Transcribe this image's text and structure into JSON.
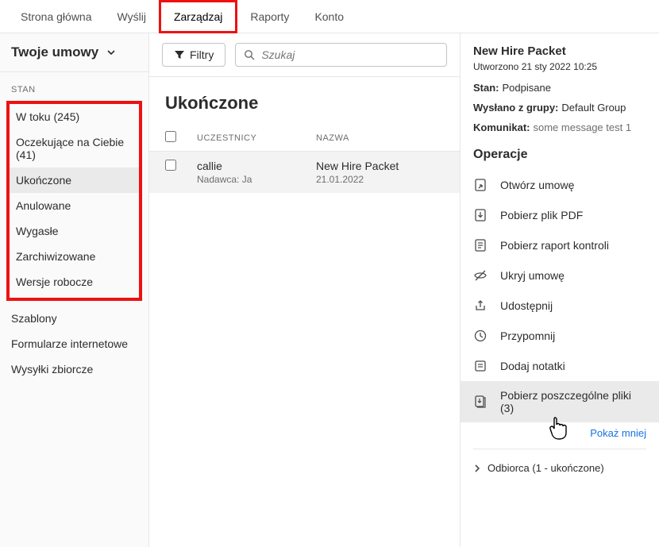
{
  "topnav": [
    {
      "label": "Strona główna",
      "name": "nav-home"
    },
    {
      "label": "Wyślij",
      "name": "nav-send"
    },
    {
      "label": "Zarządzaj",
      "name": "nav-manage",
      "highlighted": true
    },
    {
      "label": "Raporty",
      "name": "nav-reports"
    },
    {
      "label": "Konto",
      "name": "nav-account"
    }
  ],
  "sidebar": {
    "title": "Twoje umowy",
    "stan_label": "STAN",
    "status_items": [
      {
        "label": "W toku (245)",
        "name": "status-in-progress"
      },
      {
        "label": "Oczekujące na Ciebie (41)",
        "name": "status-waiting-for-you"
      },
      {
        "label": "Ukończone",
        "name": "status-completed",
        "active": true
      },
      {
        "label": "Anulowane",
        "name": "status-cancelled"
      },
      {
        "label": "Wygasłe",
        "name": "status-expired"
      },
      {
        "label": "Zarchiwizowane",
        "name": "status-archived"
      },
      {
        "label": "Wersje robocze",
        "name": "status-drafts"
      }
    ],
    "other_items": [
      {
        "label": "Szablony",
        "name": "sidebar-templates"
      },
      {
        "label": "Formularze internetowe",
        "name": "sidebar-webforms"
      },
      {
        "label": "Wysyłki zbiorcze",
        "name": "sidebar-bulk-send"
      }
    ]
  },
  "center": {
    "filter_label": "Filtry",
    "search_placeholder": "Szukaj",
    "title": "Ukończone",
    "columns": {
      "uczestnicy": "UCZESTNICY",
      "nazwa": "NAZWA"
    },
    "rows": [
      {
        "participant": "callie",
        "sender_label": "Nadawca: Ja",
        "name": "New Hire Packet",
        "date": "21.01.2022"
      }
    ]
  },
  "right": {
    "title": "New Hire Packet",
    "created_label": "Utworzono 21 sty 2022 10:25",
    "stan_label": "Stan:",
    "stan_value": "Podpisane",
    "group_label": "Wysłano z grupy:",
    "group_value": "Default Group",
    "message_label": "Komunikat:",
    "message_value": "some message test 1",
    "ops_title": "Operacje",
    "ops": [
      {
        "label": "Otwórz umowę",
        "name": "op-open-agreement",
        "icon": "open"
      },
      {
        "label": "Pobierz plik PDF",
        "name": "op-download-pdf",
        "icon": "pdf"
      },
      {
        "label": "Pobierz raport kontroli",
        "name": "op-download-audit",
        "icon": "audit"
      },
      {
        "label": "Ukryj umowę",
        "name": "op-hide-agreement",
        "icon": "hide"
      },
      {
        "label": "Udostępnij",
        "name": "op-share",
        "icon": "share"
      },
      {
        "label": "Przypomnij",
        "name": "op-remind",
        "icon": "remind"
      },
      {
        "label": "Dodaj notatki",
        "name": "op-add-notes",
        "icon": "notes"
      },
      {
        "label": "Pobierz poszczególne pliki  (3)",
        "name": "op-download-files",
        "icon": "files",
        "hl": true
      }
    ],
    "show_less": "Pokaż mniej",
    "recipient_label": "Odbiorca (1 - ukończone)"
  }
}
